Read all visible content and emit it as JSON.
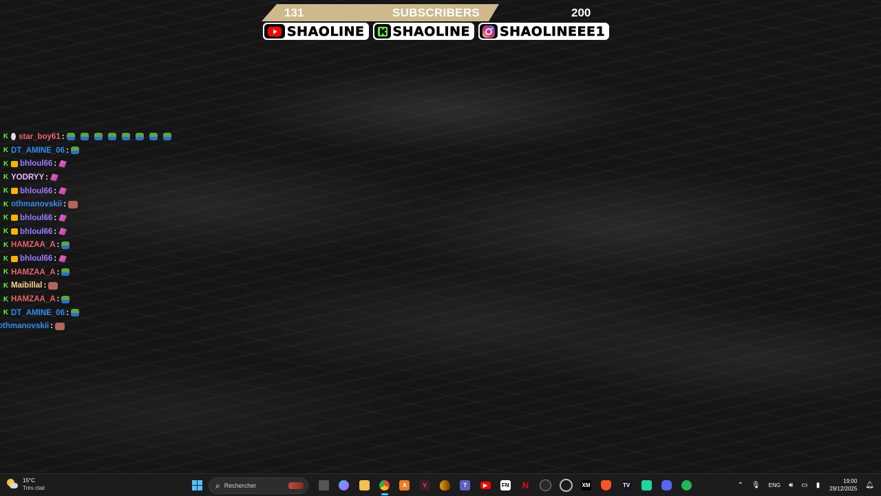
{
  "overlay": {
    "goal": {
      "current": "131",
      "title": "SUBSCRIBERS",
      "target": "200"
    },
    "socials": [
      {
        "icon": "youtube-icon",
        "name": "SHAOLINE"
      },
      {
        "icon": "kick-icon",
        "name": "SHAOLINE"
      },
      {
        "icon": "instagram-icon",
        "name": "SHAOLINEEE1"
      }
    ]
  },
  "chat": {
    "messages": [
      {
        "user": "star_boy61"
      },
      {
        "user": "DT_AMINE_06"
      },
      {
        "user": "bhloul66"
      },
      {
        "user": "YODRYY"
      },
      {
        "user": "bhloul66"
      },
      {
        "user": "othmanovskii"
      },
      {
        "user": "bhloul66"
      },
      {
        "user": "bhloul66"
      },
      {
        "user": "HAMZAA_A"
      },
      {
        "user": "bhloul66"
      },
      {
        "user": "HAMZAA_A"
      },
      {
        "user": "Maibillal"
      },
      {
        "user": "HAMZAA_A"
      },
      {
        "user": "DT_AMINE_06"
      },
      {
        "user": "othmanovskii"
      }
    ]
  },
  "taskbar": {
    "weather": {
      "temp": "15°C",
      "condition": "Très clair"
    },
    "search_placeholder": "Rechercher",
    "apps": [
      "task-view-icon",
      "copilot-icon",
      "file-explorer-icon",
      "chrome-icon",
      "app-a-icon",
      "vegas-icon",
      "app-shield-icon",
      "teams-icon",
      "youtube-icon",
      "fn-icon",
      "netflix-icon",
      "steam-icon",
      "app-circle-icon",
      "xm-icon",
      "brave-icon",
      "tradingview-icon",
      "app-green-icon",
      "discord-icon",
      "spotify-icon"
    ],
    "tray": {
      "lang": "ENG"
    },
    "clock": {
      "time": "19:00",
      "date": "29/12/2025"
    }
  },
  "colors": {
    "goal_bar": "#cdb98c",
    "kick_green": "#53fc18",
    "accent": "#4cc2ff"
  }
}
